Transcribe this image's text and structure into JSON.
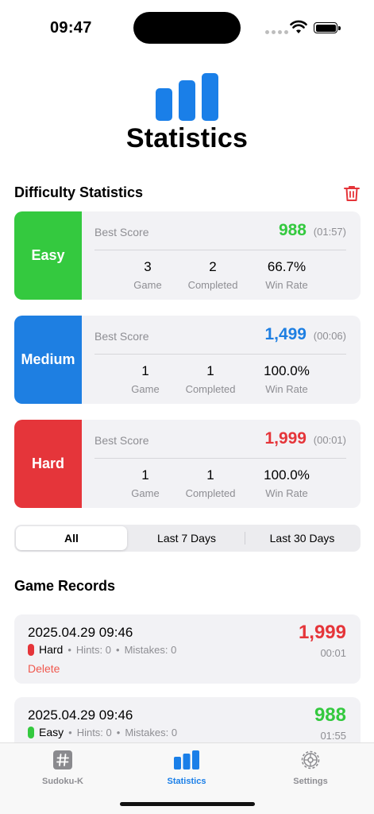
{
  "status_bar": {
    "time": "09:47"
  },
  "header": {
    "title": "Statistics"
  },
  "difficulty_section": {
    "title": "Difficulty Statistics",
    "best_score_label": "Best Score",
    "game_label": "Game",
    "completed_label": "Completed",
    "win_rate_label": "Win Rate",
    "cards": [
      {
        "name": "Easy",
        "color": "#34c93f",
        "best_score": "988",
        "best_time": "(01:57)",
        "games": "3",
        "completed": "2",
        "win_rate": "66.7%"
      },
      {
        "name": "Medium",
        "color": "#1e7fe2",
        "best_score": "1,499",
        "best_time": "(00:06)",
        "games": "1",
        "completed": "1",
        "win_rate": "100.0%"
      },
      {
        "name": "Hard",
        "color": "#e5353a",
        "best_score": "1,999",
        "best_time": "(00:01)",
        "games": "1",
        "completed": "1",
        "win_rate": "100.0%"
      }
    ]
  },
  "filter": {
    "options": [
      "All",
      "Last 7 Days",
      "Last 30 Days"
    ],
    "selected": "All"
  },
  "records_section": {
    "title": "Game Records",
    "hints_label": "Hints: 0",
    "mistakes_label": "Mistakes: 0",
    "delete_label": "Delete",
    "records": [
      {
        "date": "2025.04.29 09:46",
        "difficulty": "Hard",
        "color": "#e5353a",
        "hints": "Hints: 0",
        "mistakes": "Mistakes: 0",
        "score": "1,999",
        "time": "00:01"
      },
      {
        "date": "2025.04.29 09:46",
        "difficulty": "Easy",
        "color": "#34c93f",
        "hints": "Hints: 0",
        "mistakes": "Mistakes: 0",
        "score": "988",
        "time": "01:55"
      }
    ]
  },
  "tab_bar": {
    "tabs": [
      {
        "label": "Sudoku-K",
        "icon": "hash-icon"
      },
      {
        "label": "Statistics",
        "icon": "bar-chart-icon"
      },
      {
        "label": "Settings",
        "icon": "gear-icon"
      }
    ],
    "active": "Statistics"
  }
}
